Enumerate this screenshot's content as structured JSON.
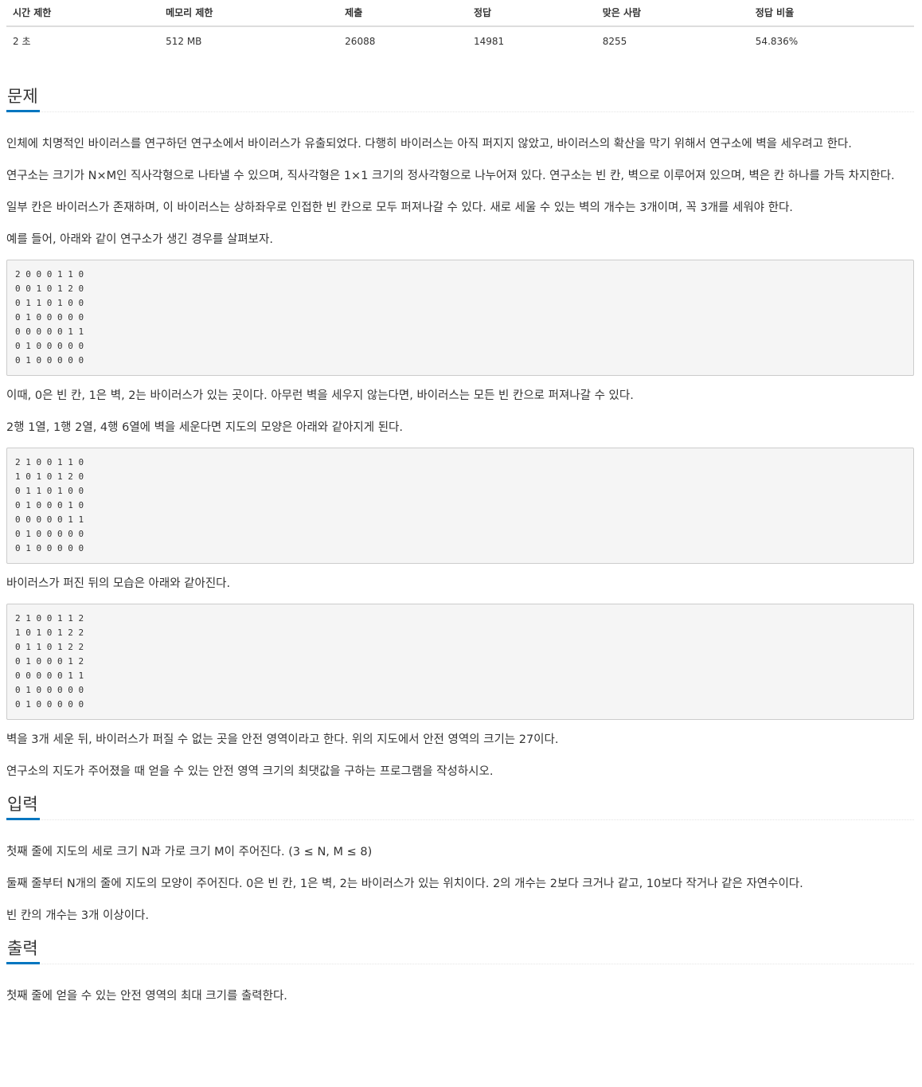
{
  "info_table": {
    "headers": [
      "시간 제한",
      "메모리 제한",
      "제출",
      "정답",
      "맞은 사람",
      "정답 비율"
    ],
    "values": [
      "2 초",
      "512 MB",
      "26088",
      "14981",
      "8255",
      "54.836%"
    ]
  },
  "problem": {
    "title": "문제",
    "p1": "인체에 치명적인 바이러스를 연구하던 연구소에서 바이러스가 유출되었다. 다행히 바이러스는 아직 퍼지지 않았고, 바이러스의 확산을 막기 위해서 연구소에 벽을 세우려고 한다.",
    "p2": "연구소는 크기가 N×M인 직사각형으로 나타낼 수 있으며, 직사각형은 1×1 크기의 정사각형으로 나누어져 있다. 연구소는 빈 칸, 벽으로 이루어져 있으며, 벽은 칸 하나를 가득 차지한다.",
    "p3": "일부 칸은 바이러스가 존재하며, 이 바이러스는 상하좌우로 인접한 빈 칸으로 모두 퍼져나갈 수 있다. 새로 세울 수 있는 벽의 개수는 3개이며, 꼭 3개를 세워야 한다.",
    "p4": "예를 들어, 아래와 같이 연구소가 생긴 경우를 살펴보자.",
    "code1": "2 0 0 0 1 1 0\n0 0 1 0 1 2 0\n0 1 1 0 1 0 0\n0 1 0 0 0 0 0\n0 0 0 0 0 1 1\n0 1 0 0 0 0 0\n0 1 0 0 0 0 0",
    "p5": "이때, 0은 빈 칸, 1은 벽, 2는 바이러스가 있는 곳이다. 아무런 벽을 세우지 않는다면, 바이러스는 모든 빈 칸으로 퍼져나갈 수 있다.",
    "p6": "2행 1열, 1행 2열, 4행 6열에 벽을 세운다면 지도의 모양은 아래와 같아지게 된다.",
    "code2": "2 1 0 0 1 1 0\n1 0 1 0 1 2 0\n0 1 1 0 1 0 0\n0 1 0 0 0 1 0\n0 0 0 0 0 1 1\n0 1 0 0 0 0 0\n0 1 0 0 0 0 0",
    "p7": "바이러스가 퍼진 뒤의 모습은 아래와 같아진다.",
    "code3": "2 1 0 0 1 1 2\n1 0 1 0 1 2 2\n0 1 1 0 1 2 2\n0 1 0 0 0 1 2\n0 0 0 0 0 1 1\n0 1 0 0 0 0 0\n0 1 0 0 0 0 0",
    "p8": "벽을 3개 세운 뒤, 바이러스가 퍼질 수 없는 곳을 안전 영역이라고 한다. 위의 지도에서 안전 영역의 크기는 27이다.",
    "p9": "연구소의 지도가 주어졌을 때 얻을 수 있는 안전 영역 크기의 최댓값을 구하는 프로그램을 작성하시오."
  },
  "input": {
    "title": "입력",
    "p1": "첫째 줄에 지도의 세로 크기 N과 가로 크기 M이 주어진다. (3 ≤ N, M ≤ 8)",
    "p2": "둘째 줄부터 N개의 줄에 지도의 모양이 주어진다. 0은 빈 칸, 1은 벽, 2는 바이러스가 있는 위치이다. 2의 개수는 2보다 크거나 같고, 10보다 작거나 같은 자연수이다.",
    "p3": "빈 칸의 개수는 3개 이상이다."
  },
  "output": {
    "title": "출력",
    "p1": "첫째 줄에 얻을 수 있는 안전 영역의 최대 크기를 출력한다."
  }
}
